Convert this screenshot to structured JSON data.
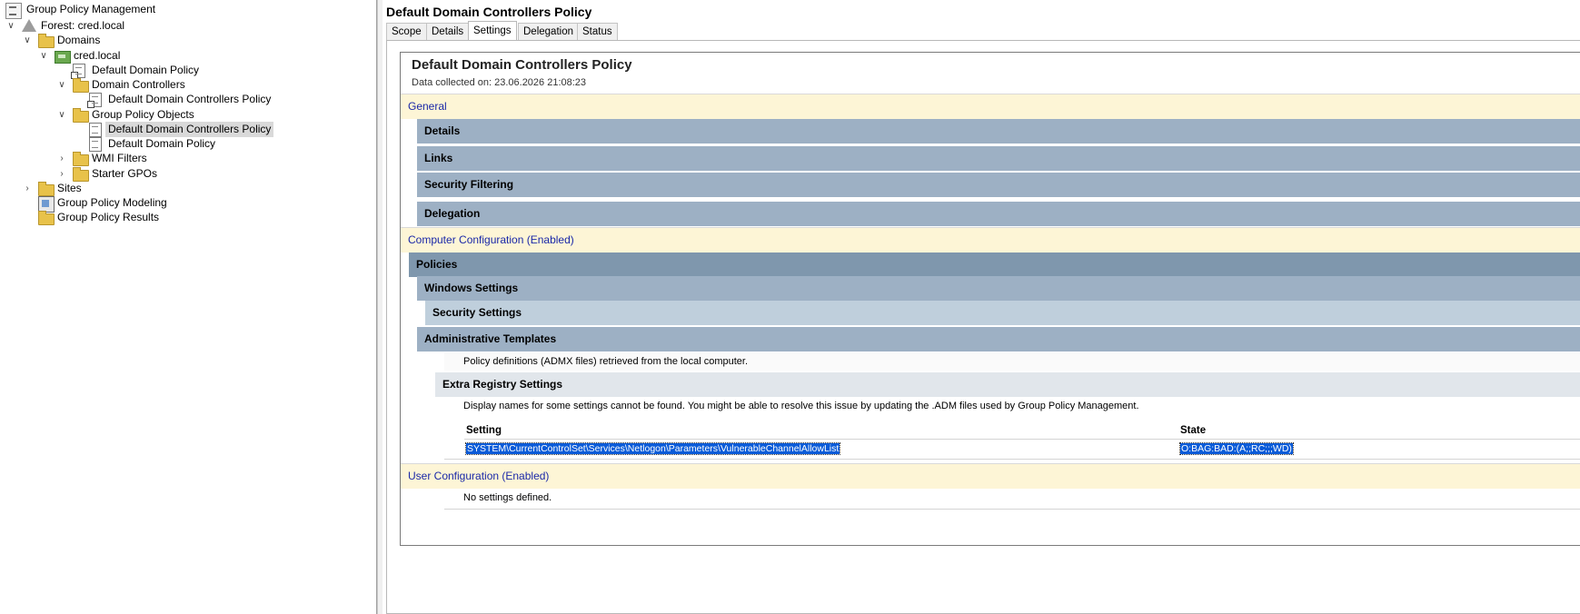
{
  "tree": {
    "root": "Group Policy Management",
    "forest": "Forest: cred.local",
    "domains": "Domains",
    "domain": "cred.local",
    "default_domain_policy_link": "Default Domain Policy",
    "domain_controllers": "Domain Controllers",
    "dc_policy_link": "Default Domain Controllers Policy",
    "gpo_container": "Group Policy Objects",
    "gpo_dc_policy": "Default Domain Controllers Policy",
    "gpo_default_policy": "Default Domain Policy",
    "wmi_filters": "WMI Filters",
    "starter_gpos": "Starter GPOs",
    "sites": "Sites",
    "modeling": "Group Policy Modeling",
    "results": "Group Policy Results"
  },
  "content": {
    "title": "Default Domain Controllers Policy",
    "tabs": [
      "Scope",
      "Details",
      "Settings",
      "Delegation",
      "Status"
    ],
    "active_tab": "Settings"
  },
  "report": {
    "title": "Default Domain Controllers Policy",
    "collected": "Data collected on: 23.06.2026 21:08:23",
    "general": "General",
    "details": "Details",
    "links": "Links",
    "security_filtering": "Security Filtering",
    "delegation": "Delegation",
    "computer_config": "Computer Configuration (Enabled)",
    "policies": "Policies",
    "windows_settings": "Windows Settings",
    "security_settings": "Security Settings",
    "admin_templates": "Administrative Templates",
    "admx_note": "Policy definitions (ADMX files) retrieved from the local computer.",
    "extra_registry": "Extra Registry Settings",
    "adm_note": "Display names for some settings cannot be found. You might be able to resolve this issue by updating the .ADM files used by Group Policy Management.",
    "col_setting": "Setting",
    "col_state": "State",
    "row_setting": "SYSTEM\\CurrentControlSet\\Services\\Netlogon\\Parameters\\VulnerableChannelAllowList",
    "row_state": "O:BAG:BAD:(A;;RC;;;WD)",
    "user_config": "User Configuration (Enabled)",
    "no_settings": "No settings defined."
  }
}
